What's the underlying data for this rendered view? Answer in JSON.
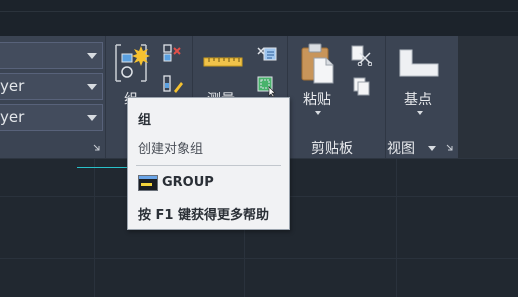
{
  "layer_dropdowns": [
    {
      "value": ""
    },
    {
      "value": "yer"
    },
    {
      "value": "yer"
    }
  ],
  "group_panel": {
    "group_button_label": "组"
  },
  "utilities_panel": {
    "measure_label": "测量"
  },
  "clipboard_panel": {
    "paste_label": "粘贴",
    "panel_title": "剪贴板"
  },
  "view_panel": {
    "base_point_label": "基点",
    "panel_title": "视图"
  },
  "tooltip": {
    "title": "组",
    "description": "创建对象组",
    "command": "GROUP",
    "help_text": "按 F1 键获得更多帮助"
  },
  "colors": {
    "ribbon_bg": "#3b4453",
    "canvas_bg": "#212830",
    "crosshair": "#29c1c9",
    "tooltip_bg": "#f1f2f4"
  }
}
